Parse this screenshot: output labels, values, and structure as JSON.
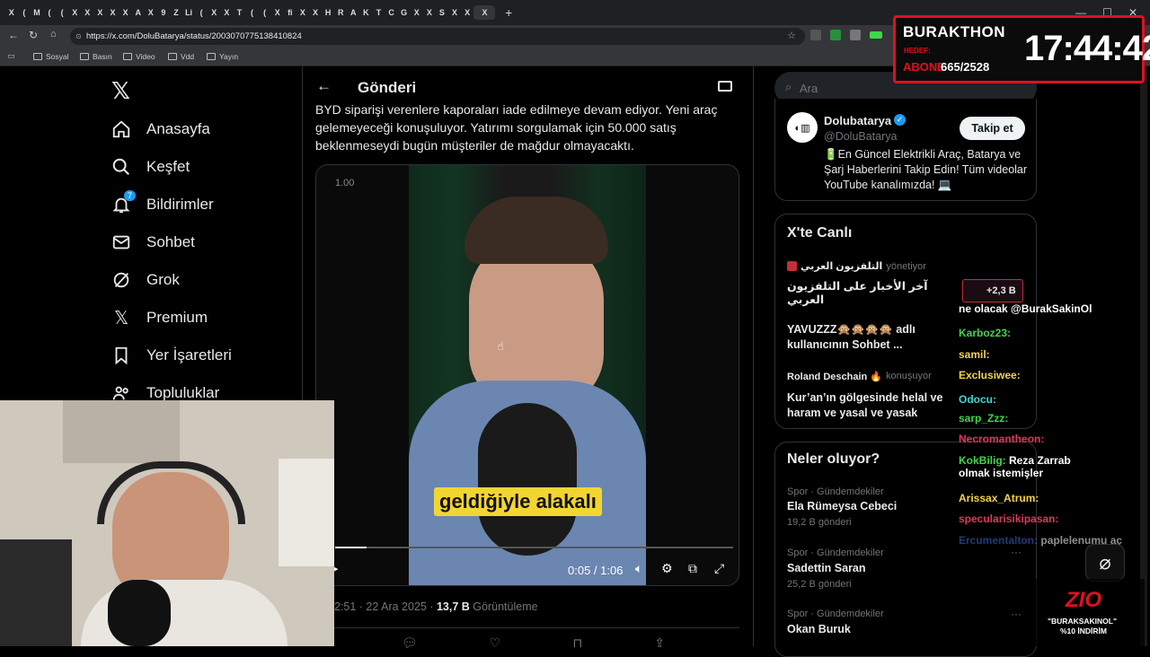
{
  "browser": {
    "url": "https://x.com/DoluBatarya/status/2003070775138410824",
    "tab_letters": [
      "X",
      "(",
      "M",
      "(",
      "(",
      "X",
      "X",
      "X",
      "X",
      "X",
      "A",
      "X",
      "9",
      "Z",
      "Li",
      "(",
      "X",
      "X",
      "T",
      "(",
      "(",
      "X",
      "fi",
      "X",
      "X",
      "H",
      "R",
      "A",
      "K",
      "T",
      "C",
      "G",
      "X",
      "X",
      "S",
      "X",
      "X",
      "X"
    ],
    "bookmarks": [
      "Sosyal",
      "Basın",
      "Video",
      "Vdd",
      "Yayın"
    ]
  },
  "nav": {
    "items": [
      "Anasayfa",
      "Keşfet",
      "Bildirimler",
      "Sohbet",
      "Grok",
      "Premium",
      "Yer İşaretleri",
      "Topluluklar"
    ],
    "notification_badge": "7"
  },
  "header": {
    "title": "Gönderi"
  },
  "post": {
    "text": "BYD siparişi verenlere kaporaları iade edilmeye devam ediyor. Yeni araç gelemeyeceği konuşuluyor. Yatırımı sorgulamak için 50.000 satış beklenmeseydi bugün müşteriler de mağdur olmayacaktı.",
    "video": {
      "speed": "1.00",
      "subtitle": "geldiğiyle alakalı",
      "time": "0:05 / 1:06",
      "progress": 0.08
    },
    "meta_time": "2:51 · 22 Ara 2025 · ",
    "views": "13,7 B",
    "views_label": "Görüntüleme"
  },
  "sidebar": {
    "search_placeholder": "Ara",
    "profile": {
      "name": "Dolubatarya",
      "handle": "@DoluBatarya",
      "follow_label": "Takip et",
      "bio": "🔋En Güncel Elektrikli Araç, Batarya ve Şarj Haberlerini Takip Edin! Tüm videolar YouTube kanalımızda! 💻"
    },
    "live": {
      "title": "X'te Canlı",
      "items": [
        {
          "host": "التلفزيون العربي",
          "role": "yönetiyor",
          "title": "آخر الأخبار على التلفزيون العربي"
        },
        {
          "host": "",
          "role": "",
          "title": "YAVUZZZ🙊🙊🙊🙊 adlı kullanıcının Sohbet ..."
        },
        {
          "host": "Roland Deschain 🔥",
          "role": "konuşuyor",
          "title": "Kur’an’ın gölgesinde helal ve haram ve yasal ve yasak"
        }
      ],
      "listeners": "+2,3 B"
    },
    "trends": {
      "title": "Neler oluyor?",
      "items": [
        {
          "category": "Spor · Gündemdekiler",
          "name": "Ela Rümeysa Cebeci",
          "count": "19,2 B gönderi"
        },
        {
          "category": "Spor · Gündemdekiler",
          "name": "Sadettin Saran",
          "count": "25,2 B gönderi"
        },
        {
          "category": "Spor · Gündemdekiler",
          "name": "Okan Buruk",
          "count": ""
        }
      ]
    }
  },
  "overlay": {
    "stream_name": "BURAKTHON",
    "subs_label": "ABONE",
    "subs_value": "665/2528",
    "goal_label": "HEDEF:",
    "clock": "17:44:42",
    "sponsor_logo": "ZIO",
    "sponsor_code": "\"BURAKSAKINOL\"",
    "sponsor_discount": "%10 İNDİRİM"
  },
  "chat": [
    {
      "user": "",
      "msg": "ne olacak @BurakSakinOl",
      "color": "#ffffff"
    },
    {
      "user": "Karboz23:",
      "msg": "",
      "color": "#3fd64a"
    },
    {
      "user": "samil:",
      "msg": "",
      "color": "#f3d24b"
    },
    {
      "user": "Exclusiwee:",
      "msg": "",
      "color": "#f3d24b"
    },
    {
      "user": "Odocu:",
      "msg": "",
      "color": "#3fd6d6"
    },
    {
      "user": "sarp_Zzz:",
      "msg": "",
      "color": "#3fd64a"
    },
    {
      "user": "Necromantheon:",
      "msg": "",
      "color": "#e0365a"
    },
    {
      "user": "KokBilig:",
      "msg": "Reza Zarrab olmak istemişler",
      "color": "#3fd64a"
    },
    {
      "user": "Arissax_Atrum:",
      "msg": "",
      "color": "#f3d24b"
    },
    {
      "user": "specularisikipasan:",
      "msg": "",
      "color": "#e0365a"
    },
    {
      "user": "Ercumentalton:",
      "msg": "paplelenumu aç",
      "color": "#3a6cd6"
    }
  ],
  "colors": {
    "accent": "#1d9bf0",
    "bg": "#000000",
    "border": "#2f3336",
    "overlay_red": "#e01020",
    "subtitle_yellow": "#f2d531"
  }
}
